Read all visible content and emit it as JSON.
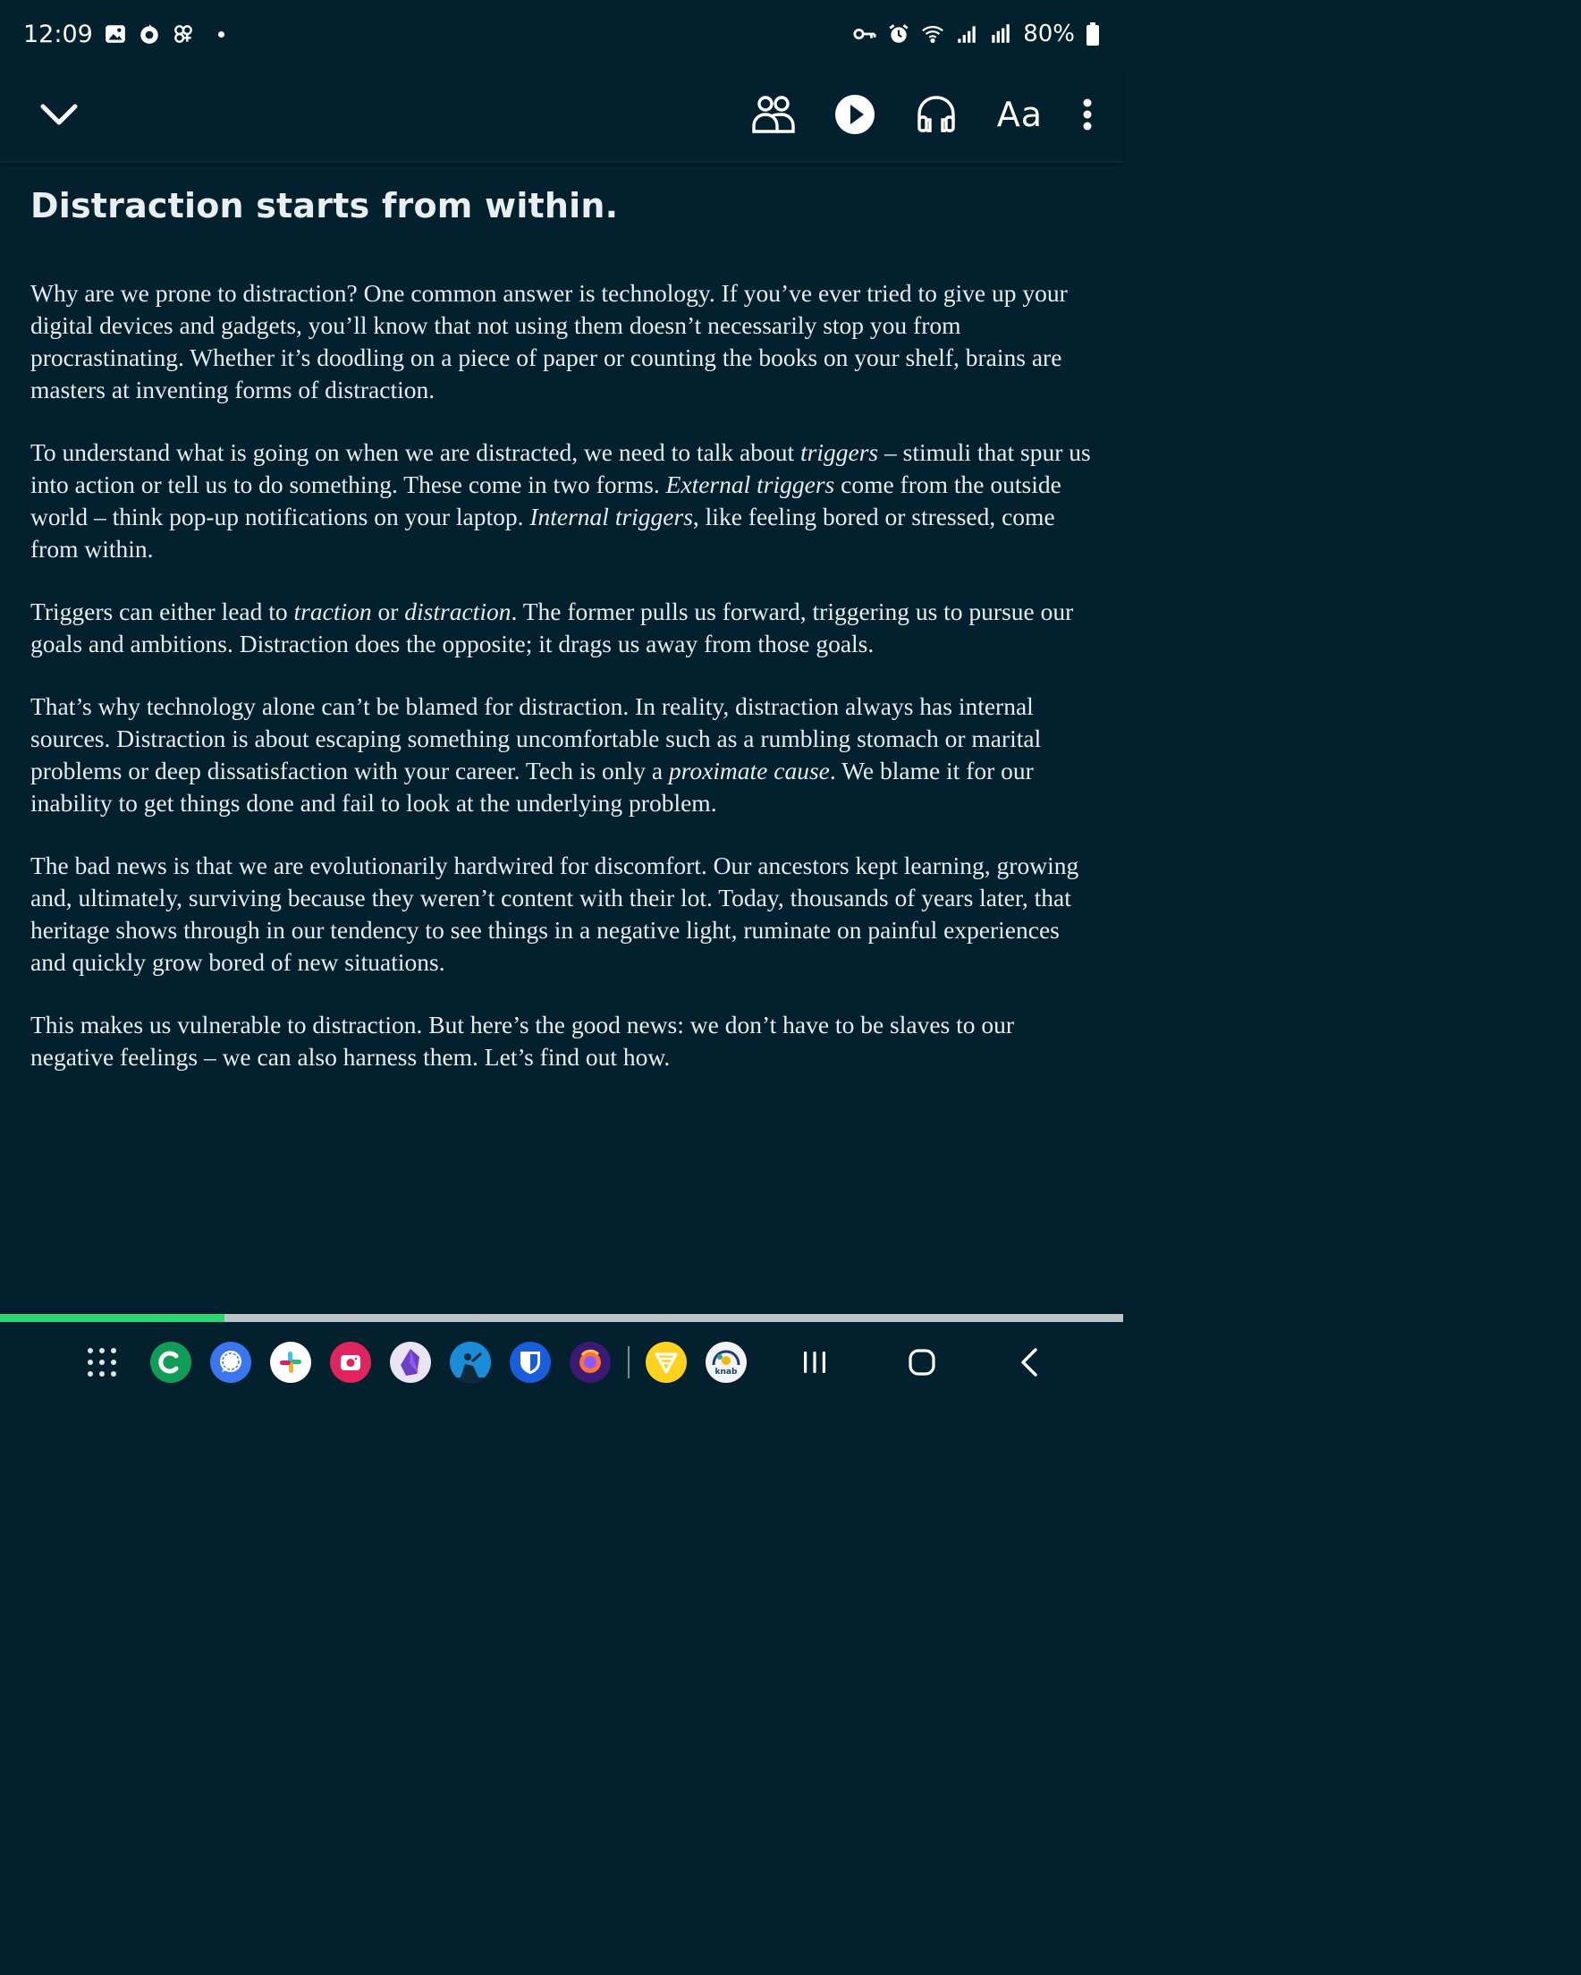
{
  "status_bar": {
    "time": "12:09",
    "battery_percent": "80%",
    "left_icons": [
      "gallery-icon",
      "sync-icon",
      "pinwheel-icon"
    ],
    "right_icons": [
      "vpn-key-icon",
      "alarm-icon",
      "wifi-icon",
      "signal-icon",
      "signal-r-icon",
      "battery-icon"
    ]
  },
  "toolbar": {
    "text_size_label": "Aa",
    "icons": [
      "collapse-chevron-icon",
      "people-icon",
      "play-icon",
      "headphones-icon",
      "more-icon"
    ]
  },
  "article": {
    "title": "Distraction starts from within.",
    "paragraphs": [
      [
        {
          "text": "Why are we prone to distraction? One common answer is technology. If you’ve ever tried to give up your digital devices and gadgets, you’ll know that not using them doesn’t necessarily stop you from procrastinating. Whether it’s doodling on a piece of paper or counting the books on your shelf, brains are masters at inventing forms of distraction."
        }
      ],
      [
        {
          "text": "To understand what is going on when we are distracted, we need to talk about "
        },
        {
          "text": "triggers",
          "italic": true
        },
        {
          "text": " – stimuli that spur us into action or tell us to do something. These come in two forms. "
        },
        {
          "text": "External triggers",
          "italic": true
        },
        {
          "text": " come from the outside world – think pop-up notifications on your laptop. "
        },
        {
          "text": "Internal triggers",
          "italic": true
        },
        {
          "text": ", like feeling bored or stressed, come from within."
        }
      ],
      [
        {
          "text": "Triggers can either lead to "
        },
        {
          "text": "traction",
          "italic": true
        },
        {
          "text": " or "
        },
        {
          "text": "distraction",
          "italic": true
        },
        {
          "text": ". The former pulls us forward, triggering us to pursue our goals and ambitions. Distraction does the opposite; it drags us away from those goals."
        }
      ],
      [
        {
          "text": "That’s why technology alone can’t be blamed for distraction. In reality, distraction always has internal sources. Distraction is about escaping something uncomfortable such as a rumbling stomach or marital problems or deep dissatisfaction with your career. Tech is only a "
        },
        {
          "text": "proximate cause",
          "italic": true
        },
        {
          "text": ". We blame it for our inability to get things done and fail to look at the underlying problem."
        }
      ],
      [
        {
          "text": "The bad news is that we are evolutionarily hardwired for discomfort. Our ancestors kept learning, growing and, ultimately, surviving because they weren’t content with their lot. Today, thousands of years later, that heritage shows through in our tendency to see things in a negative light, ruminate on painful experiences and quickly grow bored of new situations."
        }
      ],
      [
        {
          "text": "This makes us vulnerable to distraction. But here’s the good news: we don’t have to be slaves to our negative feelings – we can also harness them. Let’s find out how."
        }
      ]
    ]
  },
  "reading_progress": 0.2,
  "colors": {
    "background": "#03202e",
    "progress_fill": "#2ed573",
    "progress_track": "#b9c3c8"
  },
  "dock": {
    "apps": [
      {
        "name": "phone-app",
        "icon": "phone-c-icon",
        "color": "#0f9d58"
      },
      {
        "name": "signal-app",
        "icon": "signal-bubble-icon",
        "color": "#3a76f0"
      },
      {
        "name": "slack-app",
        "icon": "slack-icon",
        "color": "#ffffff"
      },
      {
        "name": "camera-app",
        "icon": "camera-icon",
        "color": "#e0245e"
      },
      {
        "name": "obsidian-app",
        "icon": "obsidian-gem-icon",
        "color": "#e8e4f4"
      },
      {
        "name": "kindle-app",
        "icon": "kindle-reader-icon",
        "color": "#1a8cd8"
      },
      {
        "name": "bitwarden-app",
        "icon": "bitwarden-shield-icon",
        "color": "#175ddc"
      },
      {
        "name": "firefox-app",
        "icon": "firefox-icon",
        "color": "#3b1a73"
      },
      {
        "name": "todo-app",
        "icon": "todo-icon",
        "color": "#ffd21f"
      },
      {
        "name": "knab-app",
        "icon": "knab-icon",
        "color": "#f1f3f4",
        "label": "knab"
      }
    ]
  }
}
